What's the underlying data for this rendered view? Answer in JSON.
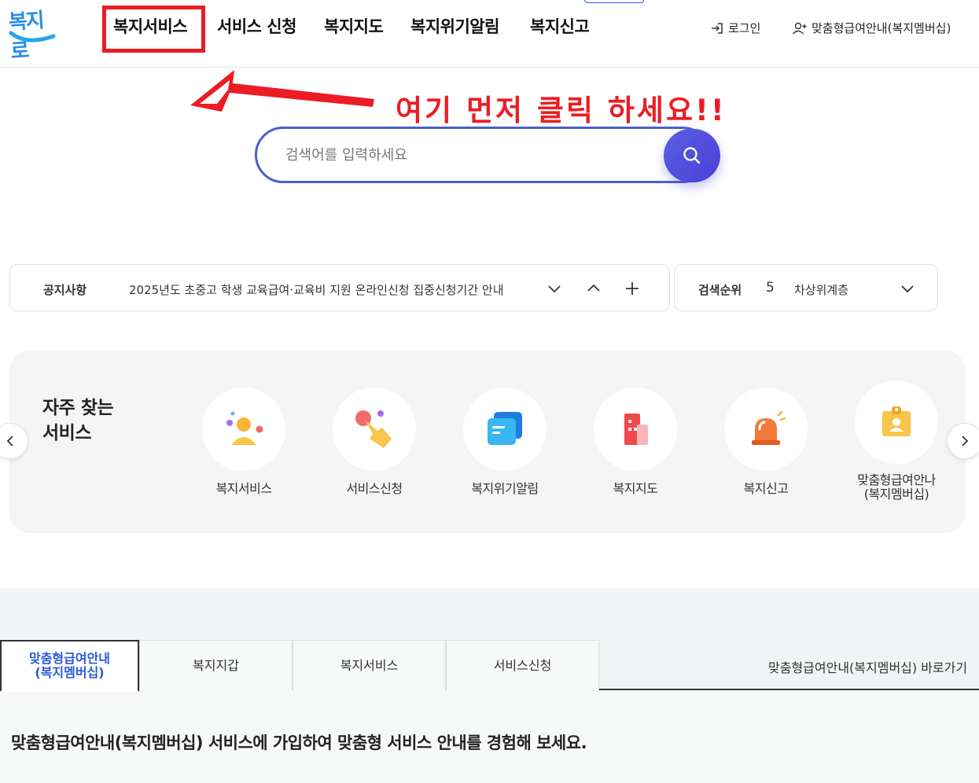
{
  "header": {
    "logo_text": "복지로",
    "nav": [
      {
        "label": "복지서비스"
      },
      {
        "label": "서비스 신청"
      },
      {
        "label": "복지지도"
      },
      {
        "label": "복지위기알림"
      },
      {
        "label": "복지신고"
      }
    ],
    "login_label": "로그인",
    "membership_label": "맞춤형급여안내(복지멤버십)"
  },
  "annotation": {
    "text": "여기 먼저 클릭 하세요!!",
    "color": "#ec1c24"
  },
  "search": {
    "placeholder": "검색어를 입력하세요",
    "value": ""
  },
  "notice": {
    "label": "공지사항",
    "text": "2025년도 초중고 학생 교육급여·교육비 지원 온라인신청 집중신청기간 안내"
  },
  "ranking": {
    "label": "검색순위",
    "rank": "5",
    "keyword": "차상위계층"
  },
  "frequent": {
    "title_line1": "자주 찾는",
    "title_line2": "서비스",
    "items": [
      {
        "label": "복지서비스",
        "icon": "person-icon"
      },
      {
        "label": "서비스신청",
        "icon": "hand-pointer-icon"
      },
      {
        "label": "복지위기알림",
        "icon": "message-card-icon"
      },
      {
        "label": "복지지도",
        "icon": "building-icon"
      },
      {
        "label": "복지신고",
        "icon": "siren-icon"
      },
      {
        "label_line1": "맞춤형급여안나",
        "label_line2": "(복지멤버십)",
        "icon": "id-badge-icon"
      }
    ]
  },
  "tabs": {
    "items": [
      {
        "label_line1": "맞춤형급여안내",
        "label_line2": "(복지멤버십)"
      },
      {
        "label": "복지지갑"
      },
      {
        "label": "복지서비스"
      },
      {
        "label": "서비스신청"
      }
    ],
    "shortcut": "맞춤형급여안내(복지멤버십) 바로가기"
  },
  "main_message": "맞춤형급여안내(복지멤버십) 서비스에 가입하여 맞춤형 서비스 안내를 경험해 보세요.",
  "colors": {
    "accent": "#4a5fd2",
    "active_tab": "#2a5bd7",
    "highlight": "#ec1c24"
  }
}
